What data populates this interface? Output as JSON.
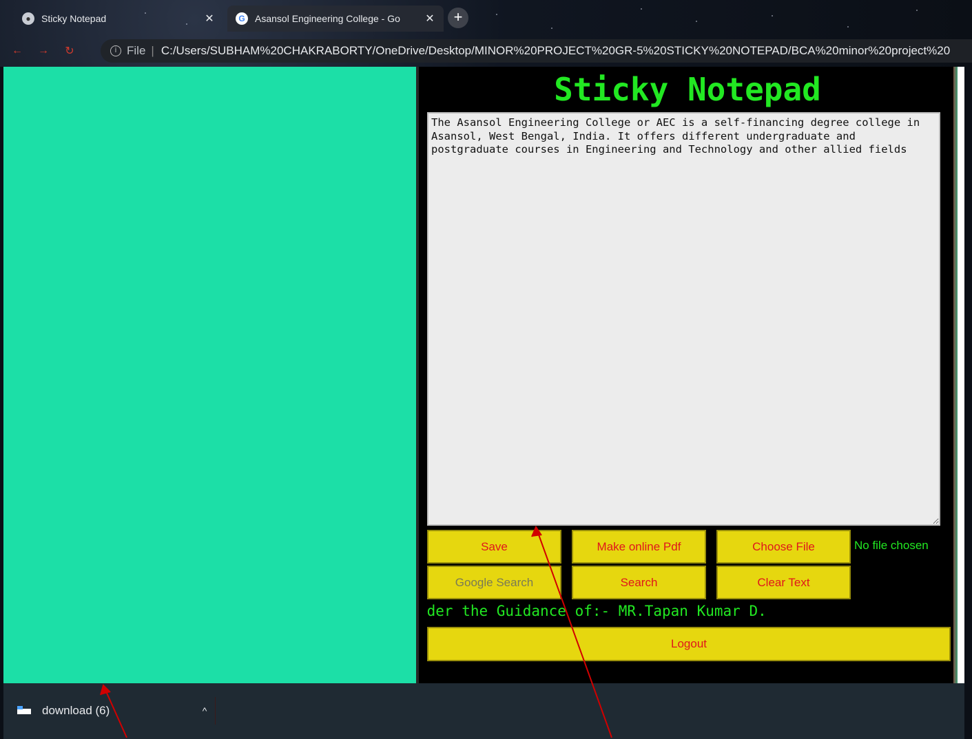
{
  "browser": {
    "tabs": [
      {
        "title": "Sticky Notepad",
        "icon": "globe-icon",
        "active": false
      },
      {
        "title": "Asansol Engineering College - Go",
        "icon": "google-g-icon",
        "active": true
      }
    ],
    "new_tab": "+",
    "close_glyph": "✕",
    "address": {
      "scheme": "File",
      "separator": "|",
      "url": "C:/Users/SUBHAM%20CHAKRABORTY/OneDrive/Desktop/MINOR%20PROJECT%20GR-5%20STICKY%20NOTEPAD/BCA%20minor%20project%20"
    }
  },
  "app": {
    "title": "Sticky Notepad",
    "note_text": "The Asansol Engineering College or AEC is a self-financing degree college in Asansol, West Bengal, India. It offers different undergraduate and postgraduate courses in Engineering and Technology and other allied fields",
    "buttons": {
      "save": "Save",
      "make_pdf": "Make online Pdf",
      "choose_file": "Choose File",
      "google_search": "Google Search",
      "search": "Search",
      "clear_text": "Clear Text",
      "logout": "Logout"
    },
    "file_status": "No file chosen",
    "marquee_text": "nar Yadav !! Under the Guidance of:- MR.Tapan Kumar D."
  },
  "colors": {
    "left_panel": "#1cdfa7",
    "app_background": "#000000",
    "title_green": "#22e822",
    "button_yellow": "#e6d70f",
    "button_text_red": "#e0161b",
    "arrow_red": "#d10000"
  },
  "download_shelf": {
    "item_label": "download (6)",
    "chevron": "^"
  }
}
